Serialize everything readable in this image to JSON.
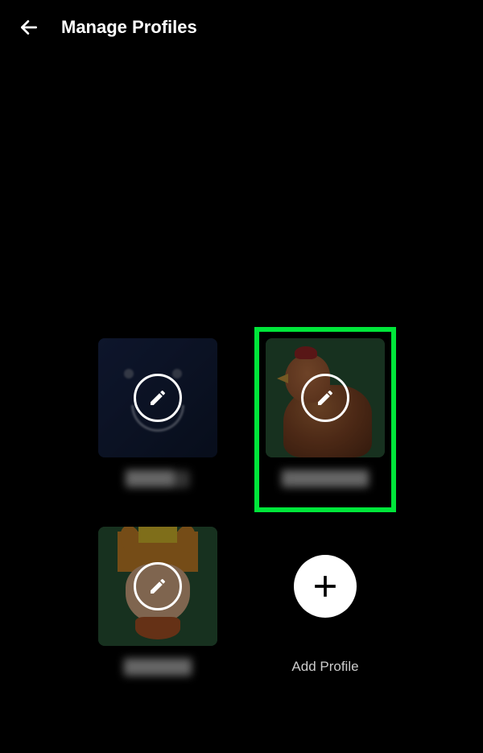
{
  "header": {
    "title": "Manage Profiles"
  },
  "profiles": [
    {
      "name": "█████",
      "avatar_kind": "blue-smiley",
      "highlighted": false
    },
    {
      "name": "█████████",
      "avatar_kind": "chicken",
      "highlighted": true
    },
    {
      "name": "███████",
      "avatar_kind": "cartoon-king",
      "highlighted": false
    }
  ],
  "add_profile": {
    "label": "Add Profile"
  },
  "colors": {
    "highlight": "#00e63a",
    "background": "#000000",
    "text": "#ffffff"
  }
}
